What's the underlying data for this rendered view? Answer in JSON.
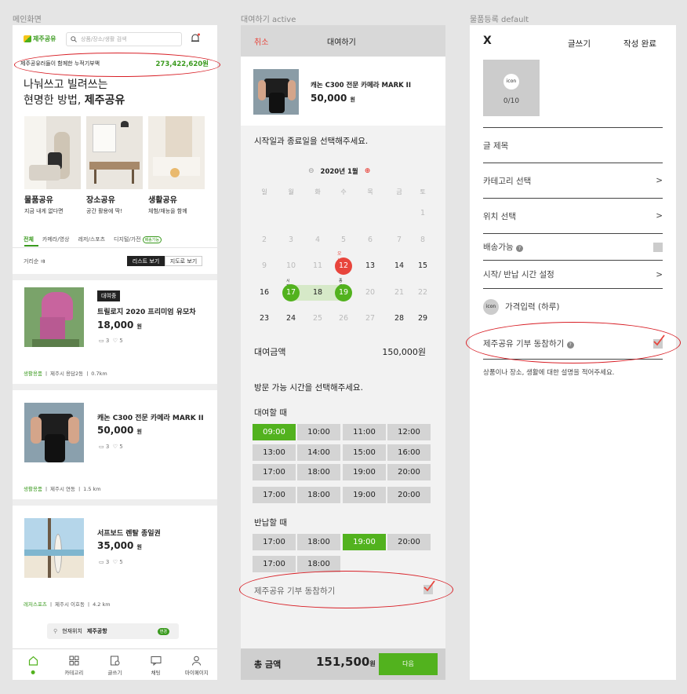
{
  "frames": {
    "main": "메인화면",
    "rental": "대여하기 active",
    "register": "물품등록 default"
  },
  "main": {
    "logo": "제주공유",
    "search_placeholder": "상품/장소/생활 검색",
    "banner_text": "제주공유러들이 함께한 누적기부액",
    "banner_amount": "273,422,620원",
    "hero_line1": "나눠쓰고 빌려쓰는",
    "hero_line2_prefix": "현명한 방법, ",
    "hero_line2_bold": "제주공유",
    "categories": [
      {
        "title": "물품공유",
        "desc": "지금 내게 없다면"
      },
      {
        "title": "장소공유",
        "desc": "공간 활용에 딱!"
      },
      {
        "title": "생활공유",
        "desc": "체험/재능을 함께"
      }
    ],
    "tabs": [
      "전체",
      "카메라/영상",
      "레저/스포츠",
      "디지털/가전"
    ],
    "tab_badge": "배송가능",
    "sort_label": "거리순",
    "list_view": "리스트 보기",
    "map_view": "지도로 보기",
    "items": [
      {
        "tag": "대여중",
        "name": "트릴로지 2020 프리미엄 유모차",
        "price": "18,000",
        "unit": "원",
        "comments": "3",
        "likes": "5",
        "category": "생활용품",
        "location": "제주시 용담2동",
        "distance": "0.7km"
      },
      {
        "tag": "",
        "name": "캐논 C300 전문 카메라 MARK II",
        "price": "50,000",
        "unit": "원",
        "comments": "3",
        "likes": "5",
        "category": "생활용품",
        "location": "제주시 연동",
        "distance": "1.5 km"
      },
      {
        "tag": "",
        "name": "서프보드 렌탈 종일권",
        "price": "35,000",
        "unit": "원",
        "comments": "3",
        "likes": "5",
        "category": "레저스포츠",
        "location": "제주시 이호동",
        "distance": "4.2 km"
      }
    ],
    "current_location_label": "현재위치",
    "current_location": "제주공항",
    "change": "변경",
    "nav": [
      "",
      "카테고리",
      "글쓰기",
      "채팅",
      "마이페이지"
    ]
  },
  "rental": {
    "cancel": "취소",
    "title": "대여하기",
    "product_name": "캐논 C300 전문 카메라 MARK II",
    "product_price": "50,000",
    "product_unit": "원",
    "date_prompt": "시작일과 종료일을 선택해주세요.",
    "month": "2020년 1월",
    "weekdays": [
      "일",
      "월",
      "화",
      "수",
      "목",
      "금",
      "토"
    ],
    "weeks": [
      [
        "",
        "",
        "",
        "",
        "",
        "",
        "1"
      ],
      [
        "2",
        "3",
        "4",
        "5",
        "6",
        "7",
        "8"
      ],
      [
        "9",
        "10",
        "11",
        "12",
        "13",
        "14",
        "15"
      ],
      [
        "16",
        "17",
        "18",
        "19",
        "20",
        "21",
        "22"
      ],
      [
        "23",
        "24",
        "25",
        "26",
        "27",
        "28",
        "29"
      ]
    ],
    "today_label": "오늘",
    "start_label": "시작",
    "end_label": "종료",
    "amount_label": "대여금액",
    "amount": "150,000원",
    "time_prompt": "방문 가능 시간을 선택해주세요.",
    "rent_label": "대여할 때",
    "rent_times": [
      "09:00",
      "10:00",
      "11:00",
      "12:00",
      "13:00",
      "14:00",
      "15:00",
      "16:00",
      "17:00",
      "18:00",
      "19:00",
      "20:00",
      "17:00",
      "18:00",
      "19:00",
      "20:00"
    ],
    "return_label": "반납할 때",
    "return_times": [
      "17:00",
      "18:00",
      "19:00",
      "20:00",
      "17:00",
      "18:00"
    ],
    "donate": "제주공유 기부 동참하기",
    "total_label": "총 금액",
    "total": "151,500",
    "total_unit": "원",
    "next": "다음"
  },
  "register": {
    "close": "X",
    "title": "글쓰기",
    "done": "작성 완료",
    "photo_icon": "icon",
    "photo_count": "0/10",
    "post_title": "글 제목",
    "category": "카테고리 선택",
    "location": "위치 선택",
    "delivery": "배송가능",
    "time": "시작/ 반납 시간 설정",
    "price_icon": "icon",
    "price": "가격입력 (하루)",
    "donate": "제주공유 기부 동참하기",
    "description": "상품이나 장소, 생활에 대한 설명을 적어주세요.",
    "chevron": ">"
  },
  "colors": {
    "accent": "#52b21e",
    "red": "#e8453c",
    "annotation": "#d81f26"
  }
}
